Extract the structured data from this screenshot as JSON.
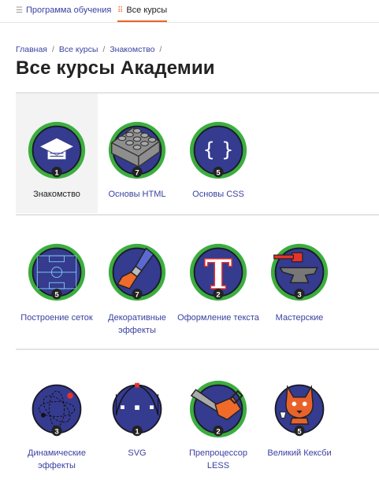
{
  "topnav": {
    "tabs": [
      {
        "label": "Программа обучения",
        "icon": "list-icon"
      },
      {
        "label": "Все курсы",
        "icon": "grid-icon",
        "active": true
      }
    ]
  },
  "breadcrumb": [
    "Главная",
    "Все курсы",
    "Знакомство"
  ],
  "title": "Все курсы Академии",
  "colors": {
    "accent": "#e8632b",
    "link": "#3a3fa0",
    "badge_ring": "#3cae3f",
    "badge_fill": "#353b8f"
  },
  "courses": [
    {
      "label": "Знакомство",
      "count": "1",
      "icon": "graduation-cap-icon",
      "active": true
    },
    {
      "label": "Основы HTML",
      "count": "7",
      "icon": "lego-brick-icon"
    },
    {
      "label": "Основы CSS",
      "count": "5",
      "icon": "curly-braces-icon"
    },
    {
      "label": "Построение сеток",
      "count": "5",
      "icon": "football-field-icon"
    },
    {
      "label": "Декоративные эффекты",
      "count": "7",
      "icon": "paintbrush-icon"
    },
    {
      "label": "Оформление текста",
      "count": "2",
      "icon": "letter-t-icon"
    },
    {
      "label": "Мастерские",
      "count": "3",
      "icon": "anvil-icon"
    },
    {
      "label": "Динамические эффекты",
      "count": "3",
      "icon": "orbit-icon"
    },
    {
      "label": "SVG",
      "count": "1",
      "icon": "vector-pen-icon"
    },
    {
      "label": "Препроцессор LESS",
      "count": "2",
      "icon": "chainsaw-icon"
    },
    {
      "label": "Великий Кексби",
      "count": "5",
      "icon": "cat-icon"
    }
  ]
}
